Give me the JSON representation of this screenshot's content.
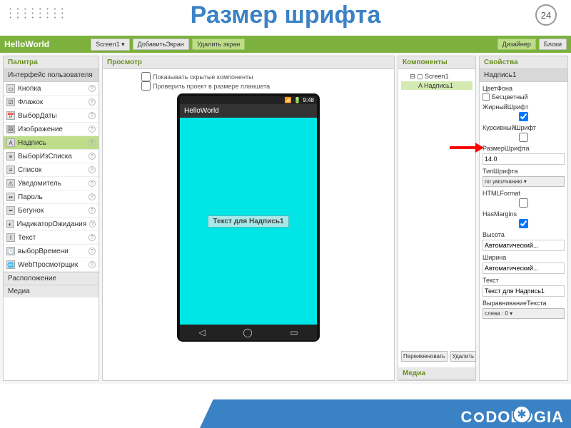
{
  "slide": {
    "title": "Размер шрифта",
    "number": "24"
  },
  "topbar": {
    "project": "HelloWorld",
    "screen": "Screen1 ▾",
    "add": "ДобавитьЭкран",
    "del": "Удалить экран",
    "designer": "Дизайнер",
    "blocks": "Блоки"
  },
  "palette": {
    "header": "Палитра",
    "ui_group": "Интерфейс пользователя",
    "items": [
      {
        "icon": "▭",
        "label": "Кнопка"
      },
      {
        "icon": "☑",
        "label": "Флажок"
      },
      {
        "icon": "📅",
        "label": "ВыборДаты"
      },
      {
        "icon": "🖼",
        "label": "Изображение"
      },
      {
        "icon": "A",
        "label": "Надпись",
        "sel": true
      },
      {
        "icon": "≡",
        "label": "ВыборИзСписка"
      },
      {
        "icon": "≡",
        "label": "Список"
      },
      {
        "icon": "⚠",
        "label": "Уведомитель"
      },
      {
        "icon": "••",
        "label": "Пароль"
      },
      {
        "icon": "━",
        "label": "Бегунок"
      },
      {
        "icon": "◐",
        "label": "ИндикаторОжидания"
      },
      {
        "icon": "I",
        "label": "Текст"
      },
      {
        "icon": "🕐",
        "label": "выборВремени"
      },
      {
        "icon": "🌐",
        "label": "WebПросмотрщик"
      }
    ],
    "layout": "Расположение",
    "media": "Медиа"
  },
  "preview": {
    "header": "Просмотр",
    "chk1": "Показывать скрытые компоненты",
    "chk2": "Проверить проект в размере планшета",
    "time": "9:48",
    "appbar": "HelloWorld",
    "label": "Текст для Надпись1"
  },
  "components": {
    "header": "Компоненты",
    "s1": "Screen1",
    "s2": "Надпись1",
    "rename": "Переименовать",
    "delete": "Удалить",
    "media": "Медиа"
  },
  "props": {
    "header": "Свойства",
    "comp": "Надпись1",
    "bg": "ЦветФона",
    "bg_val": "Бесцветный",
    "bold": "ЖирныйШрифт",
    "bold_chk": true,
    "italic": "КурсивныйШрифт",
    "italic_chk": false,
    "size": "РазмерШрифта",
    "size_val": "14.0",
    "face": "ТипШрифта",
    "face_val": "по умолчанию ▾",
    "html": "HTMLFormat",
    "html_chk": false,
    "margins": "HasMargins",
    "margins_chk": true,
    "height": "Высота",
    "height_val": "Автоматический...",
    "width": "Ширина",
    "width_val": "Автоматический...",
    "text": "Текст",
    "text_val": "Текст для Надпись1",
    "align": "ВыравниваниеТекста",
    "align_val": "слева : 0 ▾"
  },
  "footer": {
    "logo_pre": "C",
    "logo_post": "DOLOGIA"
  }
}
